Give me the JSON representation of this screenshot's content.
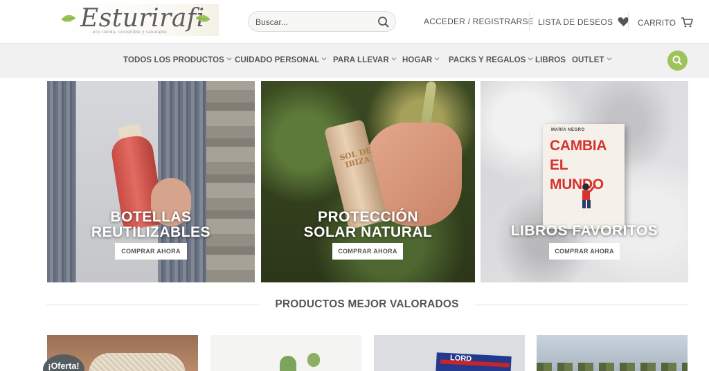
{
  "header": {
    "logo_text": "Esturirafi",
    "logo_tagline": "eco tienda, sostenible y saludable",
    "search_placeholder": "Buscar...",
    "login_label": "ACCEDER / REGISTRARSE",
    "wishlist_label": "LISTA DE DESEOS",
    "cart_label": "CARRITO"
  },
  "nav": {
    "items": [
      {
        "label": "TODOS LOS PRODUCTOS",
        "has_dropdown": true
      },
      {
        "label": "CUIDADO PERSONAL",
        "has_dropdown": true
      },
      {
        "label": "PARA LLEVAR",
        "has_dropdown": true
      },
      {
        "label": "HOGAR",
        "has_dropdown": true
      },
      {
        "label": "PACKS Y REGALOS",
        "has_dropdown": true
      },
      {
        "label": "LIBROS",
        "has_dropdown": false
      },
      {
        "label": "OUTLET",
        "has_dropdown": true
      }
    ]
  },
  "banners": [
    {
      "title_line1": "BOTELLAS",
      "title_line2": "REUTILIZABLES",
      "button": "COMPRAR AHORA"
    },
    {
      "title_line1": "PROTECCIÓN",
      "title_line2": "SOLAR NATURAL",
      "button": "COMPRAR AHORA",
      "product_text": "SOL DE IBIZA"
    },
    {
      "title_line1": "LIBROS FAVORITOS",
      "button": "COMPRAR AHORA",
      "book_author": "MARÍA NEGRO",
      "book_title": "CAMBIA EL MUNDO"
    }
  ],
  "section": {
    "title": "PRODUCTOS MEJOR VALORADOS"
  },
  "products": [
    {
      "badge": "¡Oferta!"
    },
    {},
    {
      "brand_text": "LORD"
    },
    {}
  ],
  "colors": {
    "accent_green": "#9dc45a",
    "text_gray": "#555555",
    "nav_bg": "#f1f1f1",
    "badge_bg": "#555d60"
  }
}
